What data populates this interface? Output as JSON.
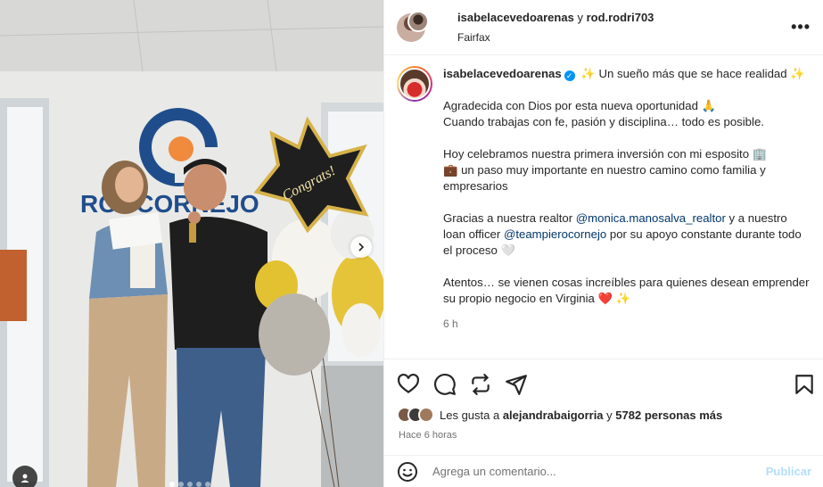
{
  "post_image": {
    "sign_text": "RODCORNEJO",
    "balloon_text": "Congrats!"
  },
  "header": {
    "user1": "isabelacevedoarenas",
    "connector": "y",
    "user2": "rod.rodri703",
    "location": "Fairfax",
    "more_icon": "more-horizontal-icon"
  },
  "caption": {
    "username": "isabelacevedoarenas",
    "line1": "✨ Un sueño más que se hace realidad ✨",
    "p2a": "Agradecida con Dios por esta nueva oportunidad 🙏",
    "p2b": "Cuando trabajas con fe, pasión y disciplina… todo es posible.",
    "p3a": "Hoy celebramos nuestra primera inversión con mi esposito 🏢",
    "p3b": "💼 un paso muy importante en nuestro camino como familia y empresarios",
    "p4_pre": "Gracias a nuestra realtor ",
    "p4_m1": "@monica.manosalva_realtor",
    "p4_mid": " y a nuestro loan officer ",
    "p4_m2": "@teampierocornejo",
    "p4_post": " por su apoyo constante durante todo el proceso 🤍",
    "p5": "Atentos… se vienen cosas increíbles para quienes desean emprender su propio negocio en Virginia ❤️ ✨",
    "time": "6 h"
  },
  "likes": {
    "prefix": "Les gusta a ",
    "user": "alejandrabaigorria",
    "mid": " y ",
    "count": "5782 personas más"
  },
  "posted": "Hace 6 horas",
  "comment": {
    "placeholder": "Agrega un comentario...",
    "publish": "Publicar"
  },
  "colors": {
    "link": "#00376b",
    "publish": "#b2dffc",
    "verified": "#0095f6"
  }
}
